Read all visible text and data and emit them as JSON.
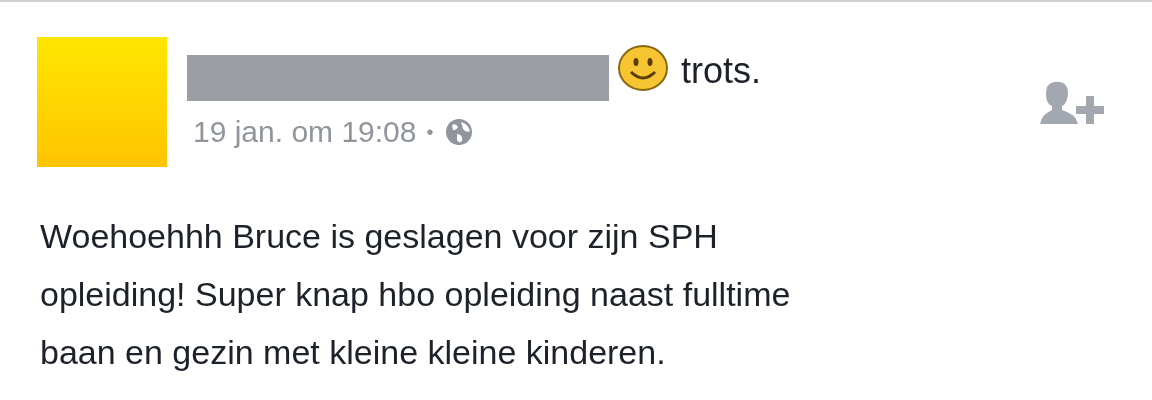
{
  "post": {
    "status_text": "trots.",
    "timestamp": "19 jan. om 19:08",
    "separator": "•",
    "body": "Woehoehhh Bruce is geslagen voor zijn SPH\nopleiding! Super knap hbo opleiding naast fulltime\nbaan en gezin met kleine kleine kinderen."
  }
}
